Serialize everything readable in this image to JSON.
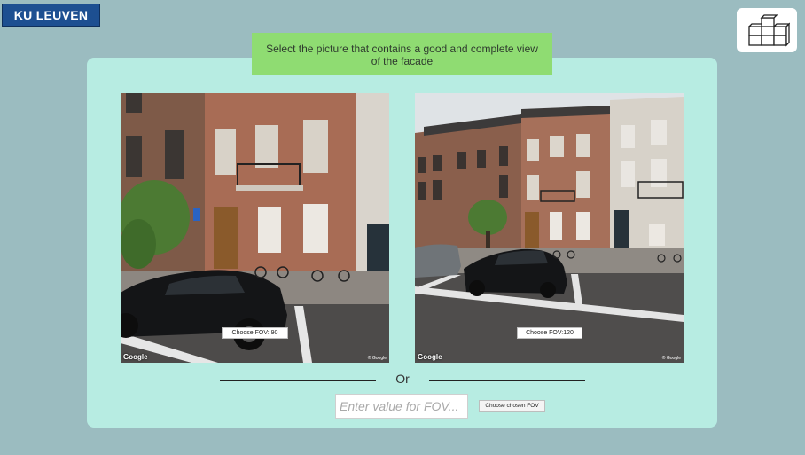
{
  "header": {
    "logo_text": "KU LEUVEN"
  },
  "instruction": "Select the picture that contains a good and complete view of the facade",
  "options": [
    {
      "fov": 90,
      "button_label": "Choose FOV: 90"
    },
    {
      "fov": 120,
      "button_label": "Choose FOV:120"
    }
  ],
  "watermark": {
    "google": "Google",
    "copyright": "© Google"
  },
  "separator_text": "Or",
  "custom_fov": {
    "value": "",
    "placeholder": "Enter value for FOV...",
    "button_label": "Choose chosen FOV"
  },
  "colors": {
    "background": "#9bbcc0",
    "panel": "#b7ece2",
    "instruction_bg": "#8fdc72",
    "logo_bg": "#1d4f91"
  }
}
